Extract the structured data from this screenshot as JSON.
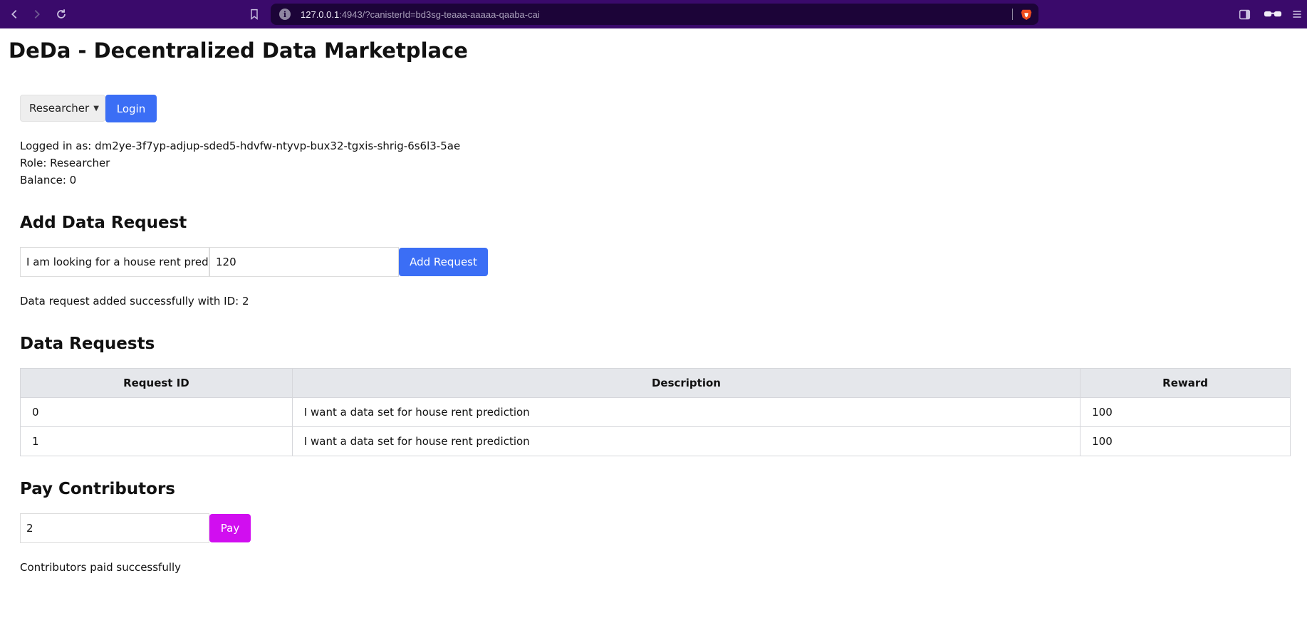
{
  "browser": {
    "url_host": "127.0.0.1",
    "url_rest": ":4943/?canisterId=bd3sg-teaaa-aaaaa-qaaba-cai",
    "icons": [
      "back-icon",
      "forward-icon",
      "reload-icon",
      "bookmark-icon",
      "site-info-icon",
      "brave-shield-icon",
      "sidebar-icon",
      "wallet-icon",
      "menu-icon"
    ],
    "colors": {
      "chrome": "#3a0a6b",
      "url_bar": "#1c0438"
    }
  },
  "page": {
    "title": "DeDa - Decentralized Data Marketplace"
  },
  "login": {
    "role_selected": "Researcher",
    "login_label": "Login",
    "logged_in_as": "Logged in as: dm2ye-3f7yp-adjup-sded5-hdvfw-ntyvp-bux32-tgxis-shrig-6s6l3-5ae",
    "role_line": "Role: Researcher",
    "balance_line": "Balance: 0"
  },
  "add_request": {
    "heading": "Add Data Request",
    "description_value": "I am looking for a house rent prediction",
    "reward_value": "120",
    "button_label": "Add Request",
    "status": "Data request added successfully with ID: 2"
  },
  "requests": {
    "heading": "Data Requests",
    "columns": [
      "Request ID",
      "Description",
      "Reward"
    ],
    "rows": [
      {
        "id": "0",
        "description": "I want a data set for house rent prediction",
        "reward": "100"
      },
      {
        "id": "1",
        "description": "I want a data set for house rent prediction",
        "reward": "100"
      }
    ]
  },
  "pay": {
    "heading": "Pay Contributors",
    "input_value": "2",
    "button_label": "Pay",
    "status": "Contributors paid successfully"
  },
  "colors": {
    "primary_button": "#3b6ef5",
    "pay_button": "#d10ef0",
    "table_header": "#e5e7eb"
  }
}
